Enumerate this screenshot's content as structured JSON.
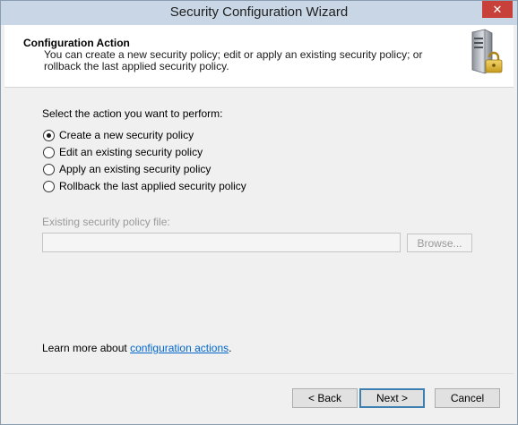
{
  "window": {
    "title": "Security Configuration Wizard",
    "close_glyph": "✕"
  },
  "header": {
    "title": "Configuration Action",
    "description": "You can create a new security policy; edit or apply an existing security policy; or rollback the last applied security policy.",
    "icon": "server-lock-icon"
  },
  "main": {
    "prompt": "Select the action you want to perform:",
    "options": [
      {
        "label": "Create a new security policy",
        "checked": true
      },
      {
        "label": "Edit an existing security policy",
        "checked": false
      },
      {
        "label": "Apply an existing security policy",
        "checked": false
      },
      {
        "label": "Rollback the last applied security policy",
        "checked": false
      }
    ],
    "file_label": "Existing security policy file:",
    "file_value": "",
    "browse_label": "Browse...",
    "learn_prefix": "Learn more about ",
    "learn_link": "configuration actions",
    "learn_suffix": "."
  },
  "footer": {
    "back_label": "< Back",
    "next_label": "Next >",
    "cancel_label": "Cancel"
  },
  "colors": {
    "titlebar": "#c8d6e5",
    "close": "#c7413a",
    "link": "#0066cc",
    "default_button_border": "#3c7fb1"
  }
}
